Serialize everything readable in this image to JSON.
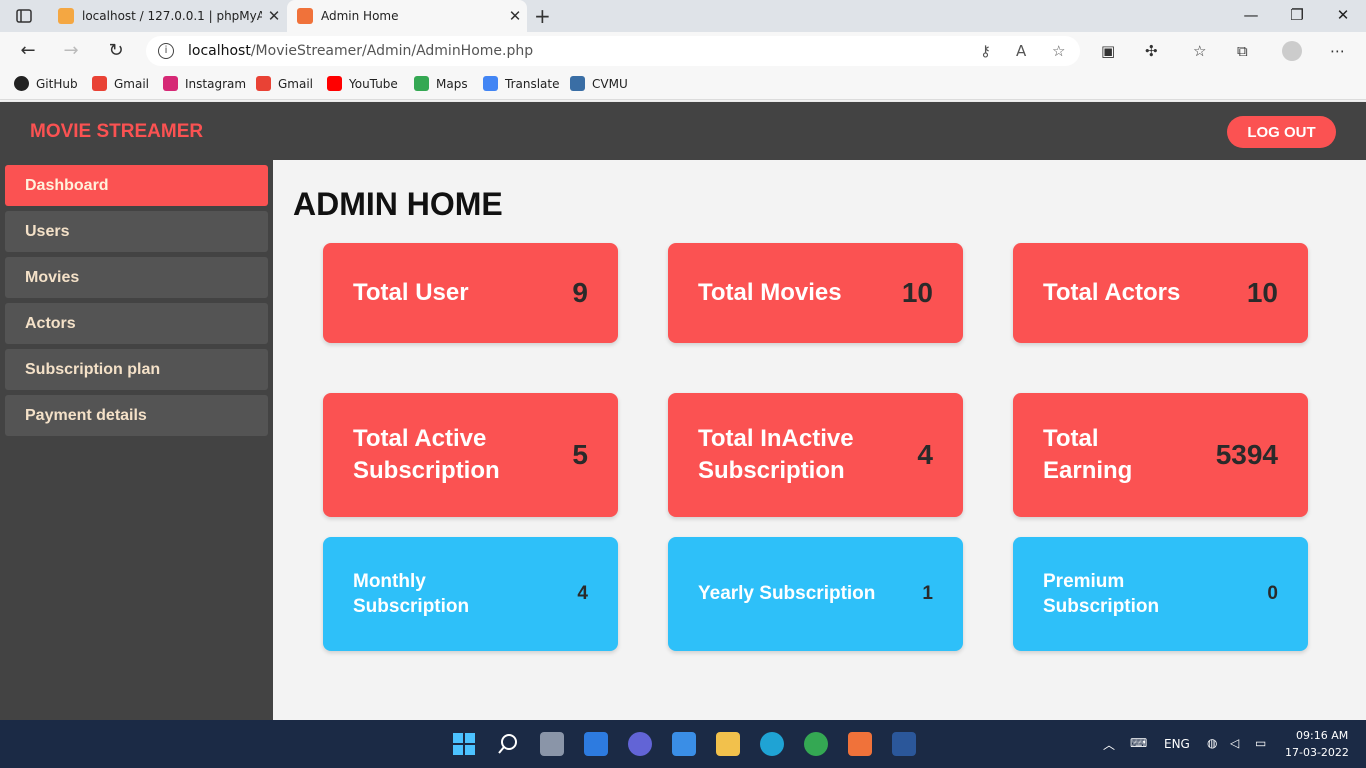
{
  "browser": {
    "tabs": [
      {
        "title": "localhost / 127.0.0.1 | phpMyAdmin"
      },
      {
        "title": "Admin Home"
      }
    ],
    "url_host": "localhost",
    "url_path": "/MovieStreamer/Admin/AdminHome.php",
    "bookmarks": [
      {
        "label": "GitHub",
        "icon": "github-icon"
      },
      {
        "label": "Gmail",
        "icon": "gmail-icon"
      },
      {
        "label": "Instagram",
        "icon": "instagram-icon"
      },
      {
        "label": "Gmail",
        "icon": "gmail-icon"
      },
      {
        "label": "YouTube",
        "icon": "youtube-icon"
      },
      {
        "label": "Maps",
        "icon": "maps-icon"
      },
      {
        "label": "Translate",
        "icon": "translate-icon"
      },
      {
        "label": "CVMU",
        "icon": "cvmu-icon"
      }
    ]
  },
  "app": {
    "brand": "MOVIE STREAMER",
    "logout_label": "LOG OUT",
    "page_title": "ADMIN HOME",
    "colors": {
      "accent": "#fb5252",
      "blue": "#2ec0f9",
      "header": "#434343"
    },
    "sidebar": [
      {
        "label": "Dashboard",
        "active": true
      },
      {
        "label": "Users"
      },
      {
        "label": "Movies"
      },
      {
        "label": "Actors"
      },
      {
        "label": "Subscription plan"
      },
      {
        "label": "Payment details"
      }
    ],
    "stats": [
      {
        "label": "Total User",
        "value": "9"
      },
      {
        "label": "Total Movies",
        "value": "10"
      },
      {
        "label": "Total Actors",
        "value": "10"
      },
      {
        "label": "Total Active Subscription",
        "value": "5"
      },
      {
        "label": "Total InActive Subscription",
        "value": "4"
      },
      {
        "label": "Total Earning",
        "value": "5394"
      }
    ],
    "plans": [
      {
        "label": "Monthly Subscription",
        "value": "4"
      },
      {
        "label": "Yearly Subscription",
        "value": "1"
      },
      {
        "label": "Premium Subscription",
        "value": "0"
      }
    ]
  },
  "taskbar": {
    "lang": "ENG",
    "time": "09:16 AM",
    "date": "17-03-2022"
  }
}
